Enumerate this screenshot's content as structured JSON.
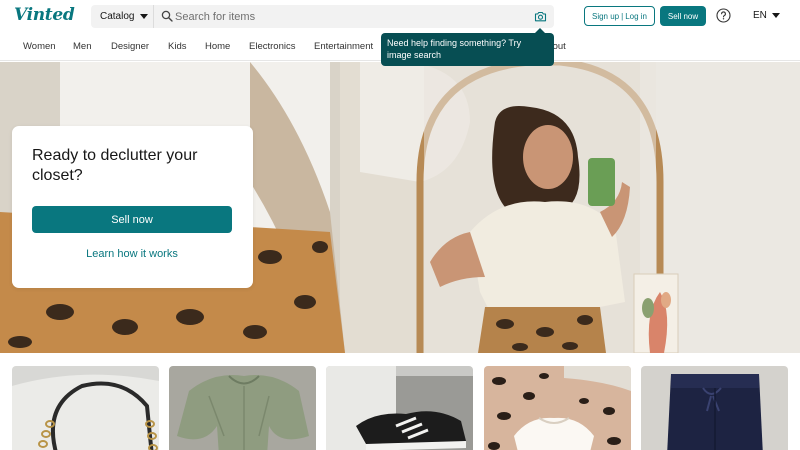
{
  "header": {
    "logo": "Vinted",
    "catalog_label": "Catalog",
    "search_placeholder": "Search for items",
    "signup_label": "Sign up",
    "separator": "|",
    "login_label": "Log in",
    "sell_label": "Sell now",
    "language": "EN"
  },
  "nav": {
    "items": [
      "Women",
      "Men",
      "Designer",
      "Kids",
      "Home",
      "Electronics",
      "Entertainment",
      "About"
    ]
  },
  "tooltip": {
    "text": "Need help finding something? Try image search"
  },
  "hero": {
    "title": "Ready to declutter your closet?",
    "sell_label": "Sell now",
    "learn_label": "Learn how it works"
  },
  "items": [
    {
      "icon": "chain-bag-photo"
    },
    {
      "icon": "green-top-photo"
    },
    {
      "icon": "sneakers-photo"
    },
    {
      "icon": "leopard-top-photo"
    },
    {
      "icon": "navy-pants-photo"
    }
  ],
  "colors": {
    "brand": "#09777f",
    "tooltip_bg": "#074e53",
    "text": "#171717"
  }
}
